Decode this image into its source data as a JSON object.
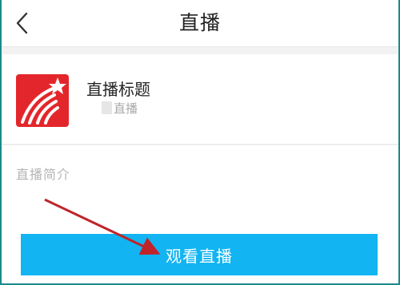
{
  "header": {
    "title": "直播",
    "back_icon": "chevron-left-icon"
  },
  "live": {
    "title": "直播标题",
    "subtitle": "直播",
    "logo_icon": "app-logo-icon"
  },
  "intro": {
    "label": "直播简介"
  },
  "action": {
    "watch_label": "观看直播"
  },
  "colors": {
    "accent": "#12b4f2",
    "logo": "#e3262b",
    "arrow": "#c0242a"
  }
}
